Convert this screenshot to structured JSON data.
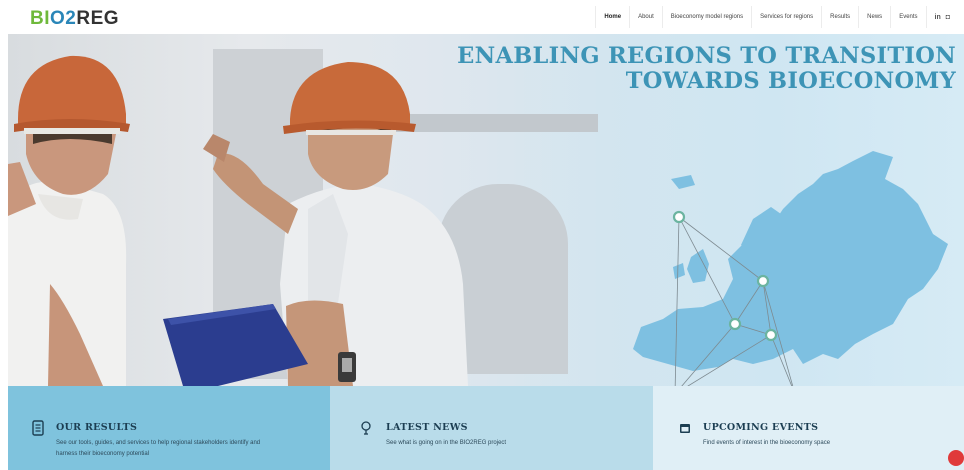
{
  "brand": {
    "logo_part1": "BI",
    "logo_part2": "O2",
    "logo_part3": "REG"
  },
  "nav": {
    "items": [
      "Home",
      "About",
      "Bioeconomy model regions",
      "Services for regions",
      "Results",
      "News",
      "Events"
    ],
    "active": "Home",
    "icons": [
      "linkedin-icon",
      "newsletter-icon"
    ],
    "linkedin_label": "in",
    "newsletter_label": "◘"
  },
  "hero": {
    "title_line1": "ENABLING REGIONS TO TRANSITION",
    "title_line2": "TOWARDS BIOECONOMY"
  },
  "features": [
    {
      "title": "OUR RESULTS",
      "text1": "See our tools, guides, and services to help regional stakeholders identify and",
      "text2": "harness their bioeconomy potential",
      "icon": "document-icon"
    },
    {
      "title": "LATEST NEWS",
      "text1": "See what is going on in the BIO2REG project",
      "icon": "lightbulb-icon"
    },
    {
      "title": "UPCOMING EVENTS",
      "text1": "Find events of interest in the bioeconomy space",
      "icon": "calendar-icon"
    }
  ],
  "colors": {
    "accent": "#3d94b6",
    "feat1": "#7fc3dd",
    "feat2": "#b9dcea",
    "feat3": "#e0eff6",
    "map": "#6fb7dc"
  }
}
